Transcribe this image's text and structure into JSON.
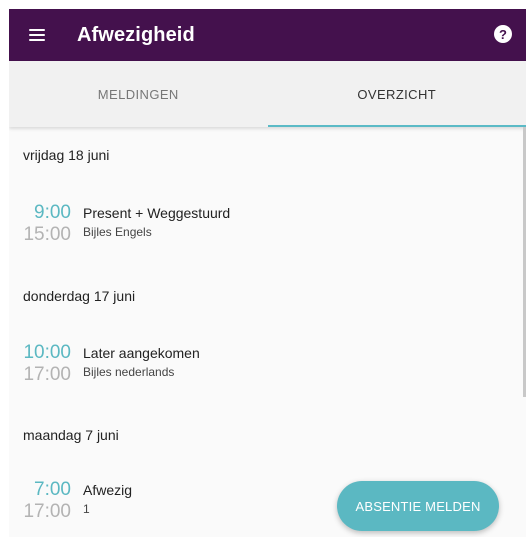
{
  "appbar": {
    "title": "Afwezigheid",
    "menu_icon": "menu-icon",
    "help_icon": "help-icon",
    "help_glyph": "?",
    "color": "#44114d"
  },
  "tabs": [
    {
      "label": "MELDINGEN",
      "active": false
    },
    {
      "label": "OVERZICHT",
      "active": true
    }
  ],
  "accent_color": "#5bb8c2",
  "days": [
    {
      "date": "vrijdag 18 juni",
      "entries": [
        {
          "start": "9:00",
          "end": "15:00",
          "status": "Present + Weggestuurd",
          "detail": "Bijles Engels"
        }
      ]
    },
    {
      "date": "donderdag 17 juni",
      "entries": [
        {
          "start": "10:00",
          "end": "17:00",
          "status": "Later aangekomen",
          "detail": "Bijles nederlands"
        }
      ]
    },
    {
      "date": "maandag 7 juni",
      "entries": [
        {
          "start": "7:00",
          "end": "17:00",
          "status": "Afwezig",
          "detail": "1"
        }
      ]
    }
  ],
  "fab": {
    "label": "ABSENTIE MELDEN"
  }
}
